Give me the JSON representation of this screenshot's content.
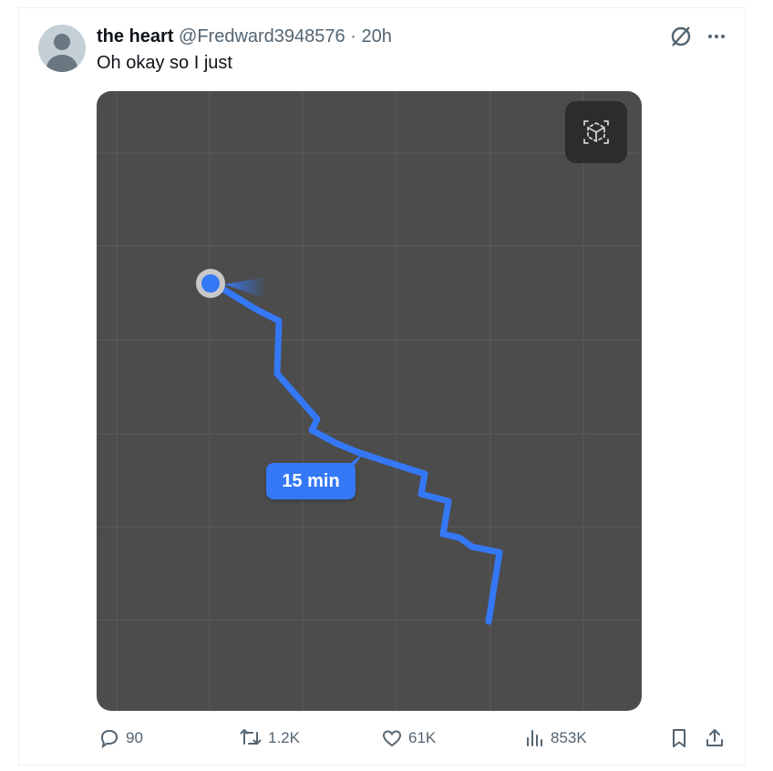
{
  "tweet": {
    "author_name": "the heart",
    "handle": "@Fredward3948576",
    "separator": "·",
    "time": "20h",
    "text": "Oh okay so I just"
  },
  "media": {
    "eta_label": "15 min",
    "map_background": "#4c4c4c",
    "route_color": "#3478f6",
    "ar_button_icon": "ar-cube-icon"
  },
  "actions": {
    "replies": "90",
    "retweets": "1.2K",
    "likes": "61K",
    "views": "853K"
  },
  "icons": {
    "reply": "reply-icon",
    "retweet": "retweet-icon",
    "like": "heart-icon",
    "views": "views-chart-icon",
    "bookmark": "bookmark-icon",
    "share": "share-icon",
    "grok": "grok-icon",
    "more": "more-icon"
  }
}
